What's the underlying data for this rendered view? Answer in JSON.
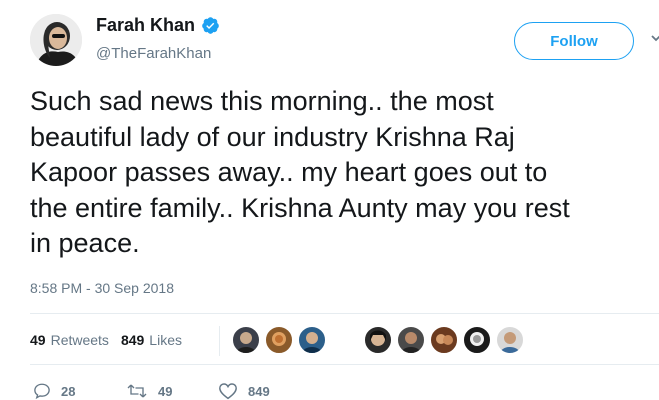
{
  "header": {
    "display_name": "Farah Khan",
    "handle": "@TheFarahKhan",
    "follow_label": "Follow"
  },
  "tweet": {
    "lines": [
      "Such sad news this morning.. the most",
      "beautiful lady of our industry Krishna Raj",
      "Kapoor passes away.. my heart goes out to",
      "the entire family.. Krishna Aunty may you rest",
      "in peace."
    ],
    "timestamp": "8:58 PM - 30 Sep 2018"
  },
  "stats": {
    "retweets_count": "49",
    "retweets_label": "Retweets",
    "likes_count": "849",
    "likes_label": "Likes"
  },
  "actions": {
    "reply_count": "28",
    "retweet_count": "49",
    "like_count": "849"
  },
  "colors": {
    "accent": "#1da1f2",
    "muted": "#657786",
    "text": "#14171a"
  }
}
